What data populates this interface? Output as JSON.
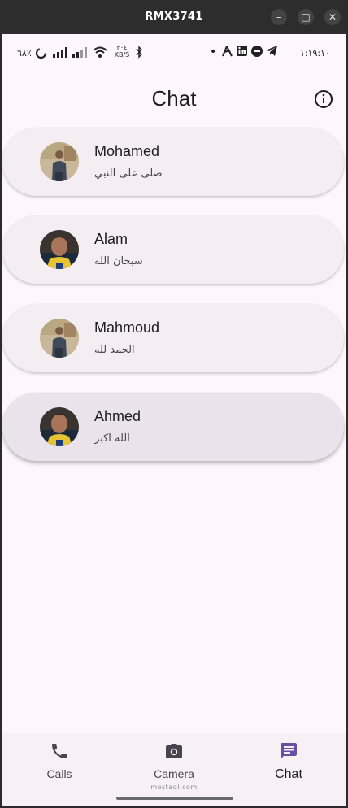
{
  "window": {
    "title": "RMX3741",
    "minimize_glyph": "–",
    "maximize_glyph": "□",
    "close_glyph": "✕"
  },
  "status_bar": {
    "battery": "٦٨٪",
    "network_speed": "٣٠٤ KB/S",
    "time": "١:١٩:١٠",
    "dot": "•"
  },
  "app_bar": {
    "title": "Chat",
    "info_icon": "info-icon"
  },
  "chats": [
    {
      "name": "Mohamed",
      "message": "صلى على النبي",
      "avatar": "avatar-man-standing",
      "selected": false
    },
    {
      "name": "Alam",
      "message": "سبحان الله",
      "avatar": "avatar-footballer",
      "selected": false
    },
    {
      "name": "Mahmoud",
      "message": "الحمد لله",
      "avatar": "avatar-man-standing",
      "selected": false
    },
    {
      "name": "Ahmed",
      "message": "الله اكبر",
      "avatar": "avatar-footballer",
      "selected": true
    }
  ],
  "bottom_nav": {
    "items": [
      {
        "label": "Calls",
        "icon": "phone-icon"
      },
      {
        "label": "Camera",
        "icon": "camera-icon"
      },
      {
        "label": "Chat",
        "icon": "chat-icon"
      }
    ],
    "active_index": 2
  },
  "watermark": "mostaql.com",
  "colors": {
    "background": "#fdf7fc",
    "card": "#f4edf1",
    "card_selected": "#ebe3ec",
    "accent": "#6750a4",
    "text": "#1d1b20"
  }
}
